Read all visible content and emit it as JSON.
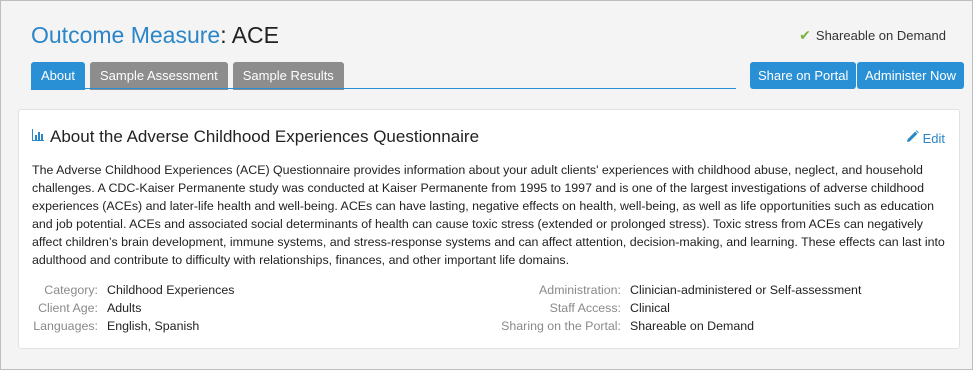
{
  "header": {
    "title_prefix": "Outcome Measure",
    "title_sep": ":",
    "title_name": " ACE",
    "share_status": "Shareable on Demand"
  },
  "tabs": [
    {
      "label": "About",
      "active": true
    },
    {
      "label": "Sample Assessment",
      "active": false
    },
    {
      "label": "Sample Results",
      "active": false
    }
  ],
  "actions": {
    "share_portal": "Share on Portal",
    "administer_now": "Administer Now"
  },
  "card": {
    "title": "About the Adverse Childhood Experiences Questionnaire",
    "edit_label": "Edit",
    "description": "The Adverse Childhood Experiences (ACE) Questionnaire provides information about your adult clients' experiences with childhood abuse, neglect, and household challenges. A CDC-Kaiser Permanente study was conducted at Kaiser Permanente from 1995 to 1997 and is one of the largest investigations of adverse childhood experiences (ACEs) and later-life health and well-being. ACEs can have lasting, negative effects on health, well-being, as well as life opportunities such as education and job potential. ACEs and associated social determinants of health can cause toxic stress (extended or prolonged stress). Toxic stress from ACEs can negatively affect children’s brain development, immune systems, and stress-response systems and can affect attention, decision-making, and learning. These effects can last into adulthood and contribute to difficulty with relationships, finances, and other important life domains."
  },
  "meta_left": [
    {
      "label": "Category:",
      "value": "Childhood Experiences"
    },
    {
      "label": "Client Age:",
      "value": "Adults"
    },
    {
      "label": "Languages:",
      "value": "English, Spanish"
    }
  ],
  "meta_right": [
    {
      "label": "Administration:",
      "value": "Clinician-administered or Self-assessment"
    },
    {
      "label": "Staff Access:",
      "value": "Clinical"
    },
    {
      "label": "Sharing on the Portal:",
      "value": "Shareable on Demand"
    }
  ],
  "icons": {
    "check": "check-icon",
    "chart": "bar-chart-icon",
    "edit": "pencil-icon"
  },
  "colors": {
    "accent": "#2a90d6",
    "tab_inactive": "#8d8d8d",
    "check": "#7ab43d"
  }
}
